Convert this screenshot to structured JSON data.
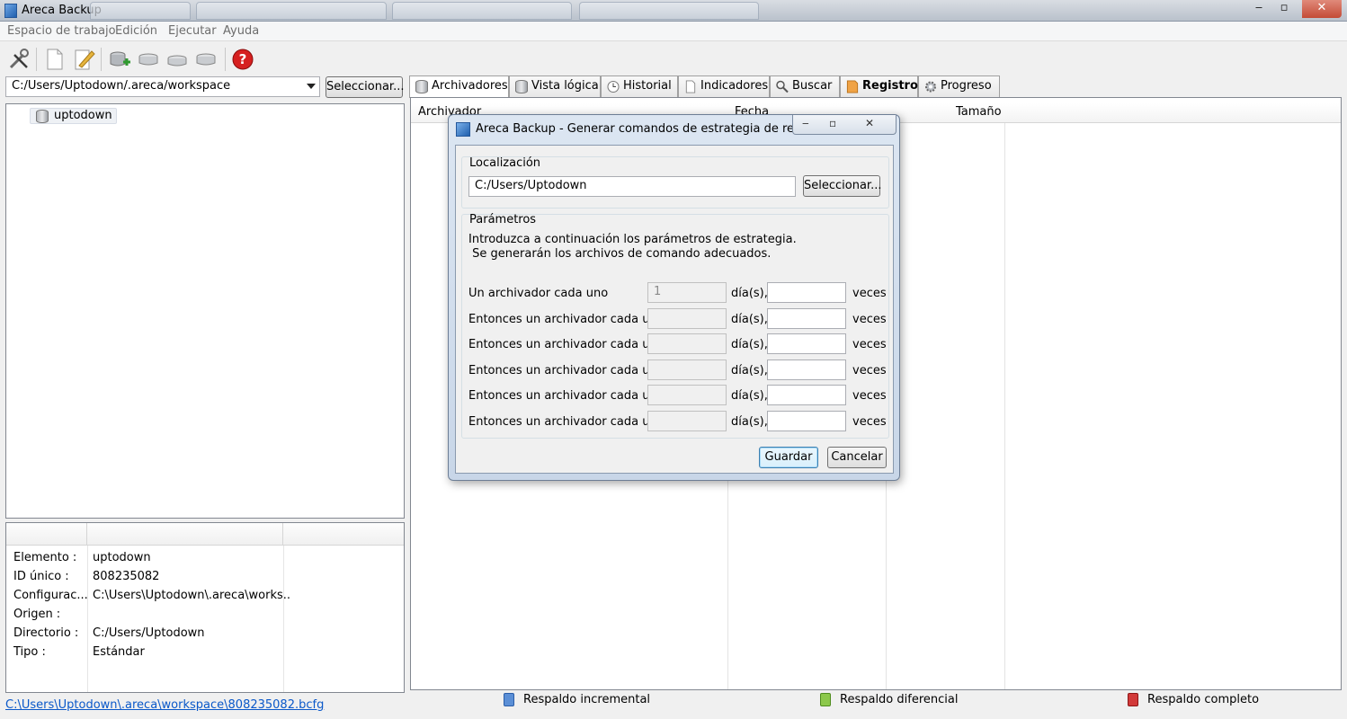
{
  "window": {
    "title": "Areca Backup",
    "controls": {
      "minimize": "‒",
      "maximize": "▫",
      "close": "✕"
    }
  },
  "menu": [
    "Espacio de trabajo",
    "Edición",
    "Ejecutar",
    "Ayuda"
  ],
  "toolbar": {
    "icons": [
      "tools-icon",
      "new-document-icon",
      "edit-icon",
      "add-target-icon",
      "group-icon",
      "group-icon",
      "group-icon",
      "help-icon"
    ]
  },
  "workspace": {
    "path": "C:/Users/Uptodown/.areca/workspace",
    "select_label": "Seleccionar..."
  },
  "tree": {
    "items": [
      "uptodown"
    ]
  },
  "properties": {
    "rows": [
      {
        "key": "Elemento :",
        "value": "uptodown"
      },
      {
        "key": "ID único :",
        "value": "808235082"
      },
      {
        "key": "Configurac...",
        "value": "C:\\Users\\Uptodown\\.areca\\works..."
      },
      {
        "key": "Origen :",
        "value": ""
      },
      {
        "key": "Directorio :",
        "value": "C:/Users/Uptodown"
      },
      {
        "key": "Tipo :",
        "value": "Estándar"
      }
    ]
  },
  "status_link": "C:\\Users\\Uptodown\\.areca\\workspace\\808235082.bcfg",
  "tabs": [
    "Archivadores",
    "Vista lógica",
    "Historial",
    "Indicadores",
    "Buscar",
    "Registro",
    "Progreso"
  ],
  "grid": {
    "columns": [
      "Archivador",
      "Fecha",
      "Tamaño"
    ]
  },
  "legend": [
    "Respaldo incremental",
    "Respaldo diferencial",
    "Respaldo completo"
  ],
  "colors": {
    "incremental": "#5b8fd6",
    "differential": "#8cc84b",
    "full": "#d23a3a"
  },
  "dialog": {
    "title": "Areca Backup - Generar comandos de estrategia de respal...",
    "location_label": "Localización",
    "location_value": "C:/Users/Uptodown",
    "select_label": "Seleccionar...",
    "params_label": "Parámetros",
    "intro_line1": "Introduzca a continuación los parámetros de estrategia.",
    "intro_line2": " Se generarán los archivos de comando adecuados.",
    "rows": [
      {
        "label": "Un archivador cada uno",
        "days": "1",
        "unit": "día(s),",
        "times": "",
        "times_unit": "veces"
      },
      {
        "label": "Entonces un archivador cada uno",
        "days": "",
        "unit": "día(s),",
        "times": "",
        "times_unit": "veces"
      },
      {
        "label": "Entonces un archivador cada uno",
        "days": "",
        "unit": "día(s),",
        "times": "",
        "times_unit": "veces"
      },
      {
        "label": "Entonces un archivador cada uno",
        "days": "",
        "unit": "día(s),",
        "times": "",
        "times_unit": "veces"
      },
      {
        "label": "Entonces un archivador cada uno",
        "days": "",
        "unit": "día(s),",
        "times": "",
        "times_unit": "veces"
      },
      {
        "label": "Entonces un archivador cada uno",
        "days": "",
        "unit": "día(s),",
        "times": "",
        "times_unit": "veces"
      }
    ],
    "save_label": "Guardar",
    "cancel_label": "Cancelar"
  }
}
